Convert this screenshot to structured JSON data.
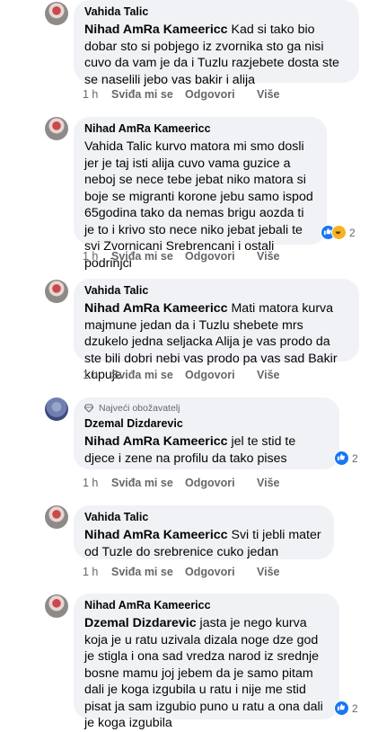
{
  "labels": {
    "like": "Sviđa mi se",
    "reply": "Odgovori",
    "more": "Više"
  },
  "comments": [
    {
      "author": "Vahida Talic",
      "mention": "Nihad AmRa Kameericc",
      "text": " Kad si tako bio dobar sto si pobjego iz zvornika sto ga nisi cuvo da vam je da i Tuzlu razjebete dosta ste se naselili jebo vas bakir i alija",
      "time": "1 h"
    },
    {
      "author": "Nihad AmRa Kameericc",
      "text": "Vahida Talic kurvo matora mi smo dosli jer je taj isti alija cuvo vama guzice a neboj se nece tebe jebat niko matora si boje se migranti korone jebu samo ispod 65godina tako da nemas brigu aozda ti je to i krivo sto nece niko jebat jebali te svi Zvornicani Srebrencani i ostali podrinjci",
      "time": "1 h",
      "reaction_count": "2"
    },
    {
      "author": "Vahida Talic",
      "mention": "Nihad AmRa Kameericc",
      "text": " Mati matora kurva majmune jedan da i Tuzlu shebete mrs dzukelo jedna seljacka Alija je vas prodo da ste bili dobri nebi vas prodo pa vas sad Bakir kupuje",
      "time": "1 h"
    },
    {
      "badge": "Najveći obožavatelj",
      "author": "Dzemal Dizdarevic",
      "mention": "Nihad AmRa Kameericc",
      "text": " jel te stid te djece i zene na profilu da tako pises",
      "time": "1 h",
      "reaction_count": "2"
    },
    {
      "author": "Vahida Talic",
      "mention": "Nihad AmRa Kameericc",
      "text": " Svi ti jebli mater od Tuzle do srebrenice cuko jedan",
      "time": "1 h"
    },
    {
      "author": "Nihad AmRa Kameericc",
      "mention": "Dzemal Dizdarevic",
      "text": " jasta je nego kurva koja je u ratu uzivala dizala noge dze god je stigla i ona sad vredza narod iz srednje bosne mamu joj jebem da je samo pitam dali je koga izgubila u ratu i nije me stid pisat ja sam izgubio puno u ratu a ona dali je koga izgubila",
      "reaction_count": "2"
    }
  ],
  "colors": {
    "bubble": "#f0f2f5",
    "meta": "#65676b",
    "like": "#1877f2",
    "haha": "#f7b125"
  }
}
